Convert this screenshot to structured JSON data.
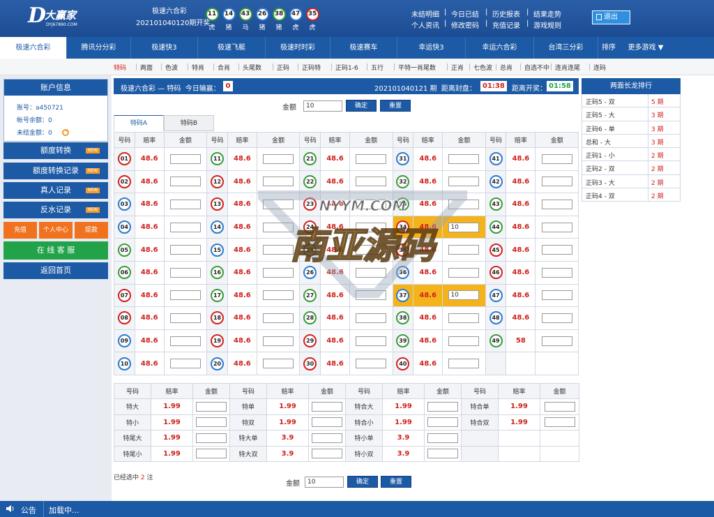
{
  "logo": {
    "letter": "D",
    "name": "大赢家",
    "sub": "DYJ67890.COM"
  },
  "header": {
    "lottery": "极速六合彩",
    "issue": "202101040120期开奖",
    "balls": [
      {
        "n": "11",
        "z": "虎",
        "c": "green"
      },
      {
        "n": "14",
        "z": "猪",
        "c": "blue"
      },
      {
        "n": "43",
        "z": "马",
        "c": "green"
      },
      {
        "n": "26",
        "z": "猪",
        "c": "blue"
      },
      {
        "n": "38",
        "z": "猪",
        "c": "green"
      },
      {
        "n": "47",
        "z": "虎",
        "c": "blue"
      },
      {
        "n": "35",
        "z": "虎",
        "c": "red"
      }
    ],
    "links": [
      "未结明细",
      "今日已结",
      "历史报表",
      "结果走势",
      "个人资讯",
      "修改密码",
      "充值记录",
      "游戏规则"
    ],
    "logout": "退出"
  },
  "nav": {
    "items": [
      "极速六合彩",
      "腾讯分分彩",
      "极速快3",
      "极速飞艇",
      "极速时时彩",
      "极速赛车",
      "幸运快3",
      "幸运六合彩",
      "台湾三分彩",
      "排序",
      "更多游戏 ▼"
    ],
    "sub": [
      "特码",
      "两面",
      "色波",
      "特肖",
      "合肖",
      "头尾数",
      "正码",
      "正码特",
      "正码1-6",
      "五行",
      "平特一肖尾数",
      "正肖",
      "七色波",
      "总肖",
      "自选不中",
      "连肖连尾",
      "连码"
    ]
  },
  "account": {
    "title": "账户信息",
    "account": "账号：a450721",
    "balance": "帐号余额：0",
    "unsettled": "未结金额：0"
  },
  "left_buttons": {
    "b1": "额度转换",
    "b2": "额度转换记录",
    "b3": "真人记录",
    "b4": "反水记录",
    "new": "NEW",
    "recharge": "充值",
    "center": "个人中心",
    "withdraw": "提款",
    "service": "在 线 客 服",
    "home": "返回首页"
  },
  "main": {
    "title": "极速六合彩 — 特码",
    "today_label": "今日输赢：",
    "today": "0",
    "issue": "202101040121 期",
    "close_label": "距离封盘：",
    "close": "01:38",
    "open_label": "距离开奖：",
    "open": "01:58",
    "amount_label": "金额",
    "amount": "10",
    "confirm": "确定",
    "reset": "重置",
    "tabA": "特码A",
    "tabB": "特码B",
    "col_no": "号码",
    "col_odds": "赔率",
    "col_amt": "金额",
    "selected_pre": "已经选中",
    "selected": "2",
    "selected_post": "注"
  },
  "numbers": {
    "odds": "48.6",
    "odds49": "58",
    "filled": {
      "34": "10",
      "37": "10"
    },
    "red": [
      1,
      2,
      7,
      8,
      12,
      13,
      18,
      19,
      23,
      24,
      29,
      30,
      34,
      35,
      40,
      45,
      46
    ],
    "blue": [
      3,
      4,
      9,
      10,
      14,
      15,
      20,
      25,
      26,
      31,
      36,
      37,
      41,
      42,
      47,
      48
    ],
    "green": [
      5,
      6,
      11,
      16,
      17,
      21,
      22,
      27,
      28,
      32,
      33,
      38,
      39,
      43,
      44,
      49
    ]
  },
  "specials": [
    [
      "特大",
      "1.99",
      "特单",
      "1.99",
      "特合大",
      "1.99",
      "特合单",
      "1.99"
    ],
    [
      "特小",
      "1.99",
      "特双",
      "1.99",
      "特合小",
      "1.99",
      "特合双",
      "1.99"
    ],
    [
      "特尾大",
      "1.99",
      "特大单",
      "3.9",
      "特小单",
      "3.9",
      "",
      ""
    ],
    [
      "特尾小",
      "1.99",
      "特大双",
      "3.9",
      "特小双",
      "3.9",
      "",
      ""
    ]
  ],
  "ranking": {
    "title": "两面长龙排行",
    "rows": [
      [
        "正码5 - 双",
        "5 期"
      ],
      [
        "正码5 - 大",
        "3 期"
      ],
      [
        "正码6 - 单",
        "3 期"
      ],
      [
        "总和 - 大",
        "3 期"
      ],
      [
        "正码1 - 小",
        "2 期"
      ],
      [
        "正码2 - 双",
        "2 期"
      ],
      [
        "正码3 - 大",
        "2 期"
      ],
      [
        "正码4 - 双",
        "2 期"
      ]
    ]
  },
  "watermark": {
    "text": "南亚源码",
    "site": "NYYM.COM"
  },
  "footer": {
    "notice": "公告",
    "loading": "加载中..."
  },
  "colors": {
    "primary": "#1d5aa5",
    "red": "#d0211c",
    "green": "#22a34a",
    "orange": "#f0721e",
    "highlight": "#f5b31b"
  }
}
